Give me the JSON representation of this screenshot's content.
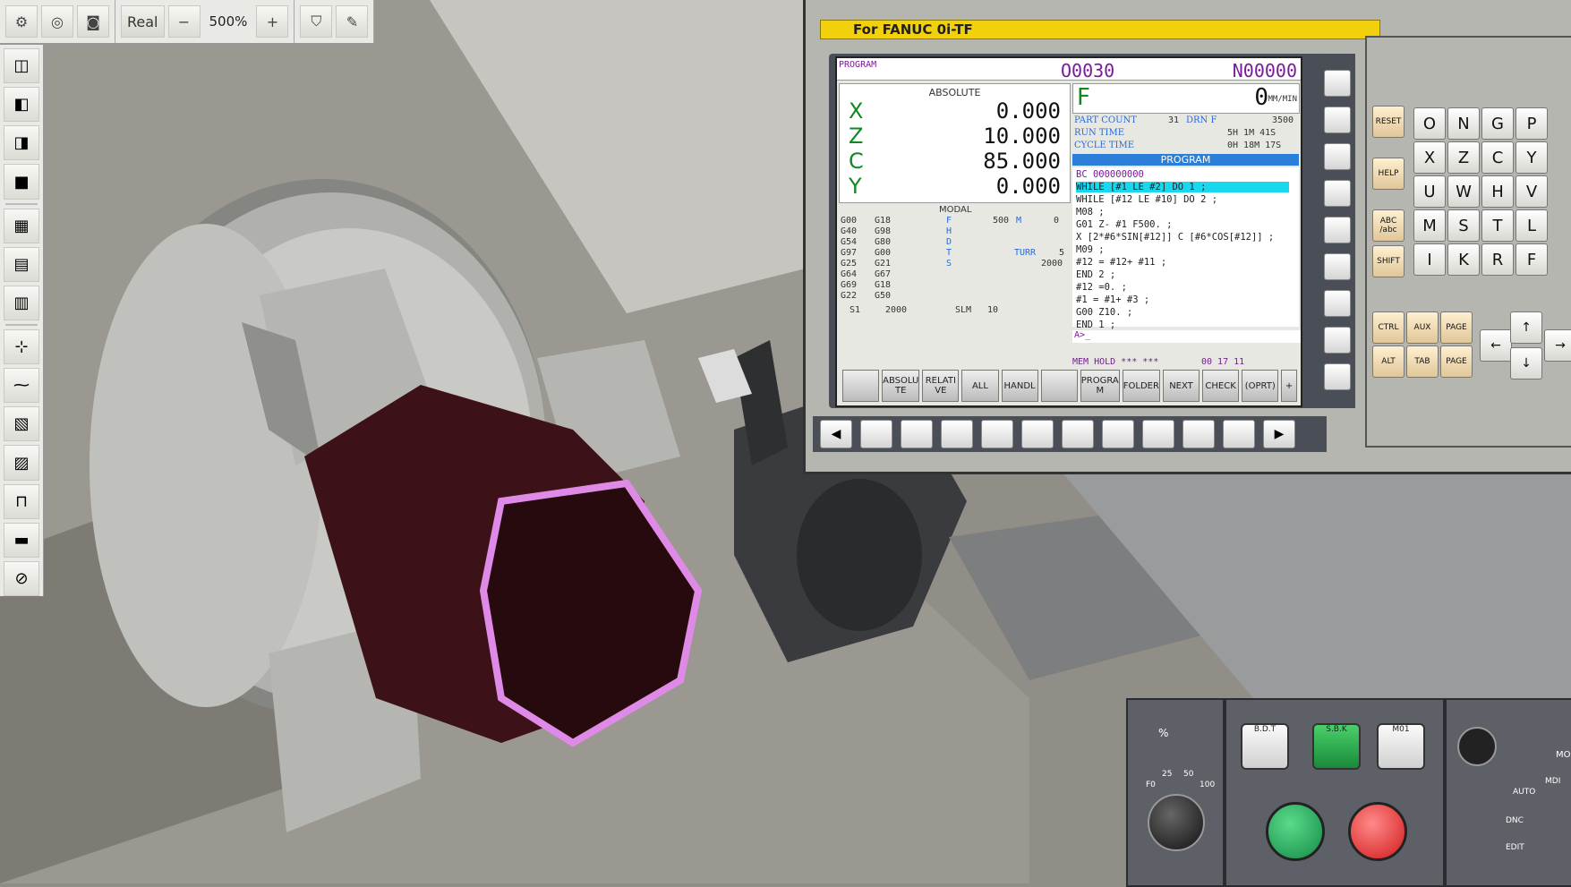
{
  "toolbar": {
    "real_label": "Real",
    "zoom": "500%",
    "minus": "−",
    "plus": "+"
  },
  "panel": {
    "title": "For FANUC 0i-TF"
  },
  "screen": {
    "program_label": "PROGRAM",
    "o_number": "O0030",
    "n_number": "N00000",
    "absolute_title": "ABSOLUTE",
    "axes": [
      {
        "axis": "X",
        "value": "0.000"
      },
      {
        "axis": "Z",
        "value": "10.000"
      },
      {
        "axis": "C",
        "value": "85.000"
      },
      {
        "axis": "Y",
        "value": "0.000"
      }
    ],
    "f_label": "F",
    "f_value": "0",
    "f_unit": "MM/MIN",
    "part_count_label": "PART COUNT",
    "part_count": "31",
    "drn_label": "DRN F",
    "drn_value": "3500",
    "run_time_label": "RUN TIME",
    "run_time": "5H  1M 41S",
    "cycle_time_label": "CYCLE TIME",
    "cycle_time": "0H 18M 17S",
    "program_bar": "PROGRAM",
    "program_lines": [
      "BC 000000000",
      "WHILE [#1 LE #2] DO 1 ;",
      "WHILE [#12 LE #10] DO 2 ;",
      "M08 ;",
      "G01 Z- #1 F500. ;",
      "X [2*#6*SIN[#12]] C [#6*COS[#12]] ;",
      "M09 ;",
      "#12 = #12+ #11 ;",
      "END 2 ;",
      "#12 =0. ;",
      "#1 = #1+ #3 ;",
      "G00 Z10. ;",
      "END 1 ;"
    ],
    "cmd_prompt": "A>_",
    "status": "MEM HOLD *** ***",
    "clock": "00 17 11",
    "modal_title": "MODAL",
    "modal_codes": [
      [
        "G00",
        "G18"
      ],
      [
        "G40",
        "G98"
      ],
      [
        "G54",
        "G80"
      ],
      [
        "G97",
        "G00"
      ],
      [
        "G25",
        "G21"
      ],
      [
        "G64",
        "G67"
      ],
      [
        "G69",
        "G18"
      ],
      [
        "G22",
        "G50"
      ]
    ],
    "modal_f": "500",
    "modal_m": "0",
    "modal_t": "5",
    "modal_s": "2000",
    "turr": "TURR",
    "s1_label": "S1",
    "s1_value": "2000",
    "slm_label": "SLM",
    "slm_value": "10",
    "softkeys_left": [
      "",
      "ABSOLU TE",
      "RELATI VE",
      "ALL",
      "HANDL",
      ""
    ],
    "softkeys_right": [
      "PROGRA M",
      "FOLDER",
      "NEXT",
      "CHECK",
      "(OPRT)",
      "+"
    ]
  },
  "keypad": {
    "reset": "RESET",
    "help": "HELP",
    "abc": "ABC /abc",
    "shift": "SHIFT",
    "ctrl": "CTRL",
    "aux": "AUX",
    "alt": "ALT",
    "tab": "TAB",
    "page_up": "PAGE",
    "page_down": "PAGE",
    "keys": [
      [
        "O",
        "N",
        "G",
        "P"
      ],
      [
        "X",
        "Z",
        "C",
        "Y"
      ],
      [
        "U",
        "W",
        "H",
        "V"
      ],
      [
        "M",
        "S",
        "T",
        "L"
      ],
      [
        "I",
        "K",
        "R",
        "F"
      ]
    ]
  },
  "op_panel": {
    "override_label": "%",
    "f0": "F0",
    "v25": "25",
    "v50": "50",
    "v100": "100",
    "bdt": "B.D.T",
    "sbk": "S.B.K",
    "m01": "M01",
    "auto": "AUTO",
    "mdi": "MDI",
    "dnc": "DNC",
    "edit": "EDIT",
    "mo": "MO"
  },
  "colors": {
    "title_bar": "#f2d10c",
    "axis_green": "#118822",
    "program_purple": "#7a1a9a",
    "highlight": "#18d8f0"
  }
}
